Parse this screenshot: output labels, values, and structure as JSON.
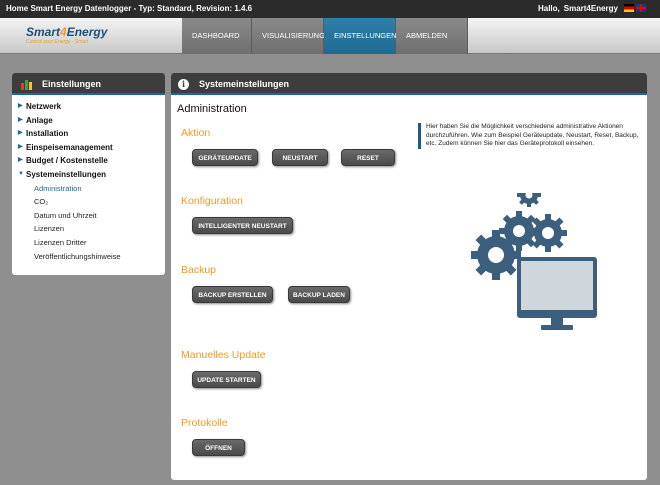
{
  "topbar": {
    "app_title": "Home Smart Energy Datenlogger - Typ: Standard, Revision: 1.4.6",
    "greeting": "Hallo,",
    "username": "Smart4Energy"
  },
  "logo": {
    "part1": "Smart",
    "part2": "4",
    "part3": "Energy",
    "tagline": "Control your Energy - Smart"
  },
  "nav": {
    "items": [
      "DASHBOARD",
      "VISUALISIERUNG",
      "EINSTELLUNGEN",
      "ABMELDEN"
    ],
    "active": "EINSTELLUNGEN"
  },
  "sidebar": {
    "title": "Einstellungen",
    "items": [
      "Netzwerk",
      "Anlage",
      "Installation",
      "Einspeisemanagement",
      "Budget / Kostenstelle",
      "Systemeinstellungen"
    ],
    "subitems": [
      "Administration",
      "CO₂",
      "Datum und Uhrzeit",
      "Lizenzen",
      "Lizenzen Dritter",
      "Veröffentlichungshinweise"
    ],
    "active_subitem": "Administration"
  },
  "main": {
    "header": "Systemeinstellungen",
    "page_title": "Administration",
    "info_text": "Hier haben Sie die Möglichkeit verschiedene administrative Aktionen durchzuführen. Wie zum Beispiel Geräteupdate, Neustart, Reset, Backup, etc. Zudem können Sie hier das Geräteprotokoll einsehen.",
    "sections": {
      "aktion": {
        "title": "Aktion",
        "buttons": [
          "GERÄTEUPDATE",
          "NEUSTART",
          "RESET"
        ]
      },
      "konfiguration": {
        "title": "Konfiguration",
        "buttons": [
          "INTELLIGENTER NEUSTART"
        ]
      },
      "backup": {
        "title": "Backup",
        "buttons": [
          "BACKUP ERSTELLEN",
          "BACKUP LADEN"
        ]
      },
      "update": {
        "title": "Manuelles Update",
        "buttons": [
          "UPDATE STARTEN"
        ]
      },
      "protokolle": {
        "title": "Protokolle",
        "buttons": [
          "ÖFFNEN"
        ]
      }
    }
  },
  "colors": {
    "accent_blue": "#1e6a92",
    "accent_orange": "#f39a1e",
    "dark_header": "#3d3d3d",
    "illustration": "#3d5f7e"
  }
}
